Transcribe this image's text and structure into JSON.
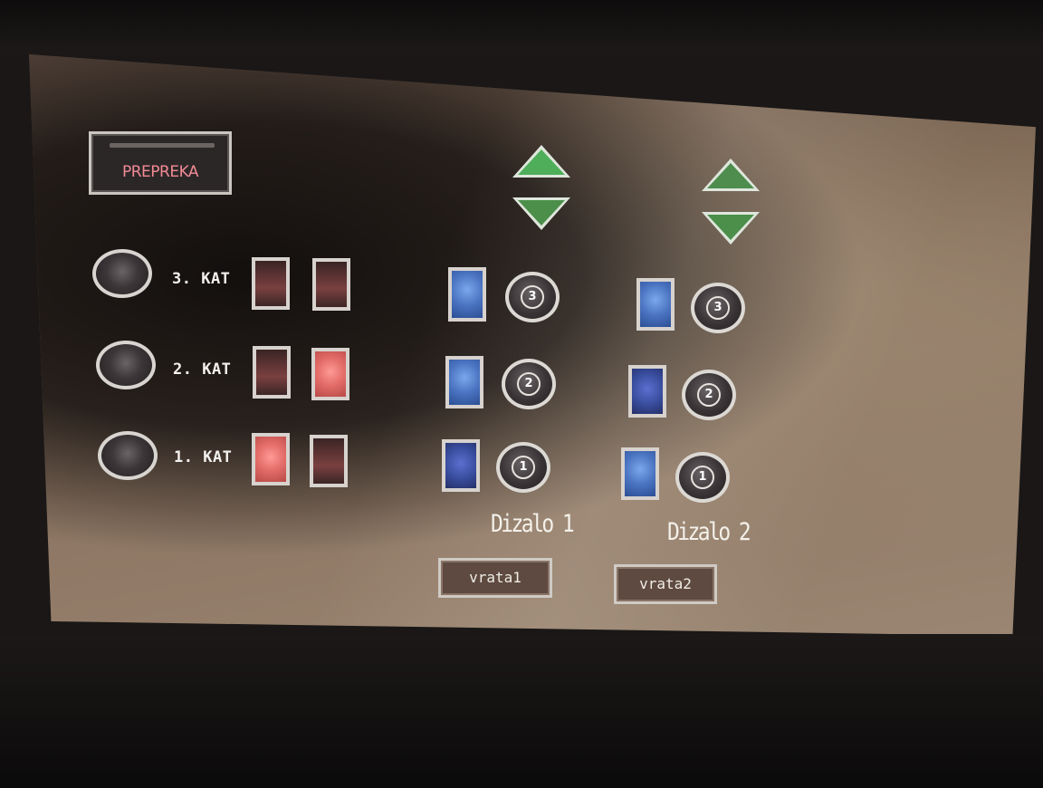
{
  "alarm": {
    "label": "PREPREKA"
  },
  "floors": [
    {
      "label": "3. KAT",
      "call_up_state": "off",
      "call_down_state": "off"
    },
    {
      "label": "2. KAT",
      "call_up_state": "off",
      "call_down_state": "on"
    },
    {
      "label": "1. KAT",
      "call_up_state": "on",
      "call_down_state": "off"
    }
  ],
  "elevators": [
    {
      "label": "Dizalo 1",
      "door_label": "vrata1",
      "floor_buttons": [
        "3",
        "2",
        "1"
      ]
    },
    {
      "label": "Dizalo 2",
      "door_label": "vrata2",
      "floor_buttons": [
        "3",
        "2",
        "1"
      ]
    }
  ],
  "colors": {
    "indicator_on": "#e46e6a",
    "indicator_off": "#5a3030",
    "elevator_indicator": "#4a73c0",
    "arrow": "#4fae5a",
    "alarm_text": "#f08a94"
  },
  "icons": {
    "up": "triangle-up-icon",
    "down": "triangle-down-icon",
    "lamp": "circle-lamp-icon"
  }
}
